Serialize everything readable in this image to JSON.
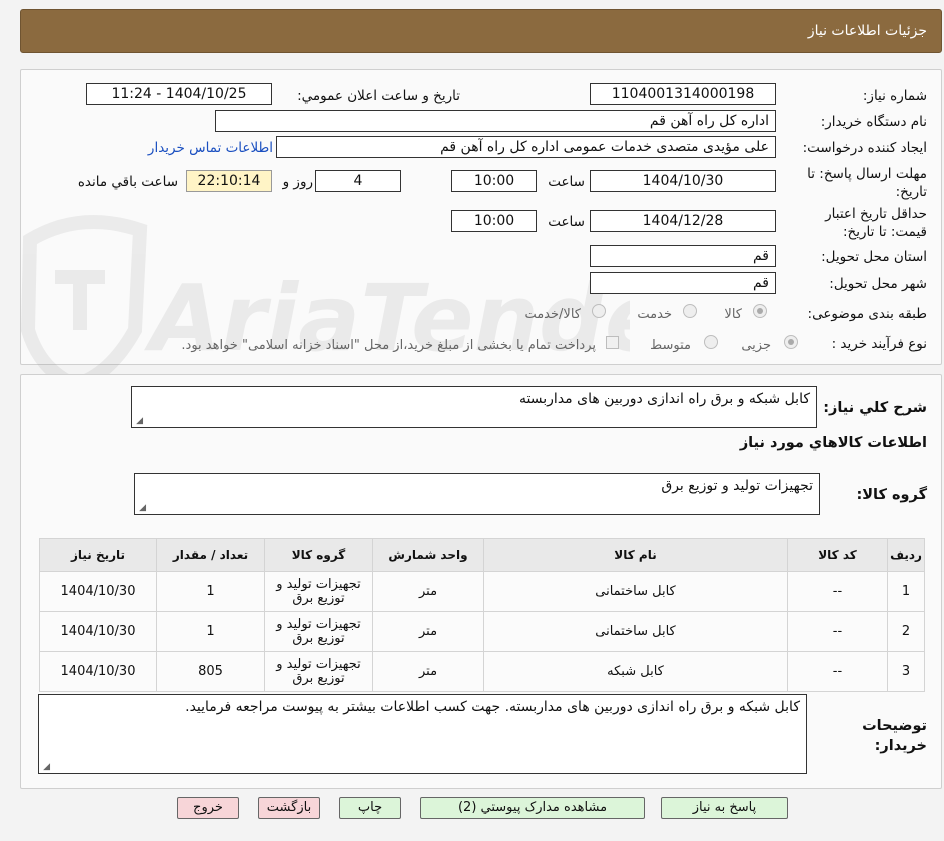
{
  "header": {
    "title": "جزئیات اطلاعات نیاز"
  },
  "form": {
    "need_number_label": "شماره نیاز:",
    "need_number": "1104001314000198",
    "announce_label": "تاریخ و ساعت اعلان عمومي:",
    "announce_value": "1404/10/25 - 11:24",
    "buyer_org_label": "نام دستگاه خریدار:",
    "buyer_org": "اداره کل  راه آهن قم",
    "requester_label": "ایجاد کننده درخواست:",
    "requester": "علی مؤیدی متصدی خدمات عمومی اداره کل  راه آهن قم",
    "contact_link": "اطلاعات تماس خریدار",
    "deadline_label": "مهلت ارسال پاسخ: تا تاریخ:",
    "deadline_date": "1404/10/30",
    "time_label": "ساعت",
    "deadline_time": "10:00",
    "days_value": "4",
    "days_label": "روز و",
    "remaining_time": "22:10:14",
    "remaining_label": "ساعت باقي مانده",
    "validity_label": "حداقل تاریخ اعتبار قیمت: تا تاریخ:",
    "validity_date": "1404/12/28",
    "validity_time": "10:00",
    "province_label": "استان محل تحویل:",
    "province": "قم",
    "city_label": "شهر محل تحویل:",
    "city": "قم",
    "category_label": "طبقه بندی موضوعی:",
    "category_options": [
      "کالا",
      "خدمت",
      "کالا/خدمت"
    ],
    "process_label": "نوع فرآیند خرید :",
    "process_options": [
      "جزیی",
      "متوسط"
    ],
    "payment_note": "پرداخت تمام یا بخشی از مبلغ خرید،از محل \"اسناد خزانه اسلامی\" خواهد بود."
  },
  "summary": {
    "label": "شرح کلي نياز:",
    "text": "کابل شبکه و برق راه اندازی دوربین های مداربسته",
    "goods_info_title": "اطلاعات کالاهاي مورد نياز",
    "goods_group_label": "گروه کالا:",
    "goods_group": "تجهیزات تولید و توزیع برق"
  },
  "table": {
    "headers": [
      "ردیف",
      "کد کالا",
      "نام کالا",
      "واحد شمارش",
      "گروه کالا",
      "تعداد / مقدار",
      "تاریخ نیاز"
    ],
    "rows": [
      [
        "1",
        "--",
        "کابل ساختمانی",
        "متر",
        "تجهیزات تولید و توزیع برق",
        "1",
        "1404/10/30"
      ],
      [
        "2",
        "--",
        "کابل ساختمانی",
        "متر",
        "تجهیزات تولید و توزیع برق",
        "1",
        "1404/10/30"
      ],
      [
        "3",
        "--",
        "کابل شبکه",
        "متر",
        "تجهیزات تولید و توزیع برق",
        "805",
        "1404/10/30"
      ]
    ]
  },
  "buyer_notes": {
    "label": "توضیحات خریدار:",
    "text": "کابل شبکه و برق راه اندازی دوربین های مداربسته. جهت کسب اطلاعات بیشتر به پیوست مراجعه فرمایید."
  },
  "buttons": {
    "reply": "پاسخ به نیاز",
    "attachments": "مشاهده مدارک پیوستي (2)",
    "print": "چاپ",
    "back": "بازگشت",
    "exit": "خروج"
  },
  "watermark": {
    "text": "AriaTender.neT"
  },
  "colors": {
    "header_bg": "#8b6a3f",
    "link": "#1a4fc0",
    "remaining_bg": "#fff4c6",
    "button_green": "#dcf5d9",
    "button_pink": "#f7d5d8"
  }
}
